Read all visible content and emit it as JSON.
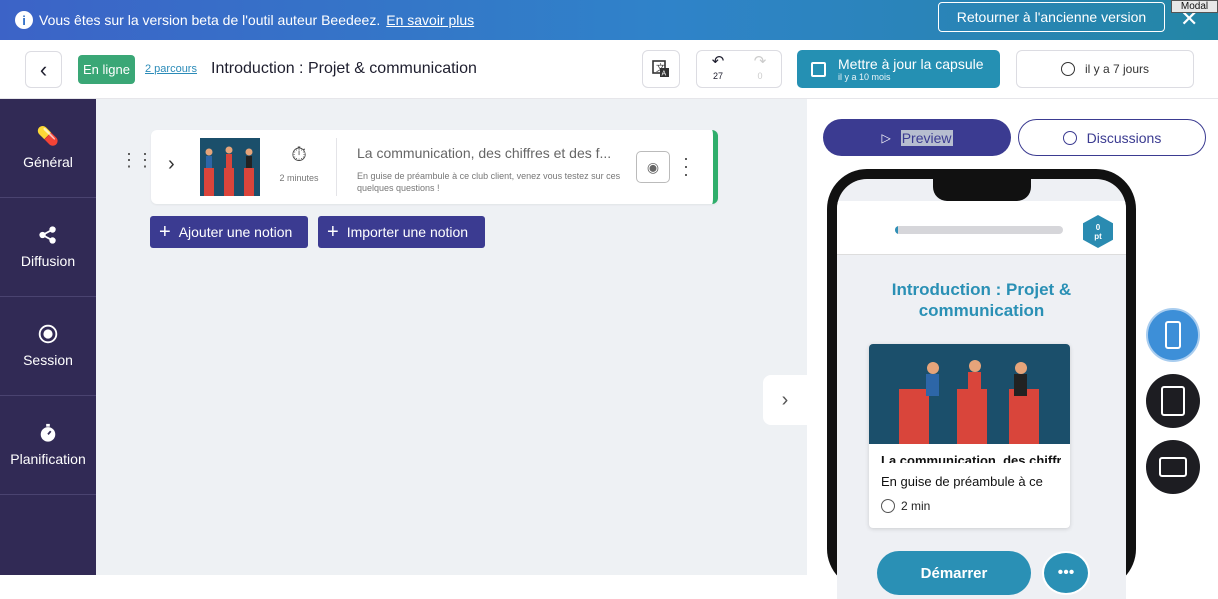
{
  "banner": {
    "message": "Vous êtes sur la version beta de l'outil auteur Beedeez.",
    "link": "En savoir plus",
    "old_version_button": "Retourner à l'ancienne version",
    "close": "✕",
    "modal_tag": "Modal"
  },
  "header": {
    "status_badge": "En ligne",
    "parcours_link": "2 parcours",
    "title": "Introduction : Projet & communication",
    "undo_count": "27",
    "redo_count": "0",
    "save_label": "Mettre à jour la capsule",
    "save_sub": "il y a 10 mois",
    "history_label": "il y a 7 jours"
  },
  "sidebar": {
    "items": [
      {
        "label": "Général",
        "icon": "pill-icon"
      },
      {
        "label": "Diffusion",
        "icon": "share-icon"
      },
      {
        "label": "Session",
        "icon": "target-icon"
      },
      {
        "label": "Planification",
        "icon": "stopwatch-icon"
      }
    ]
  },
  "notion": {
    "duration": "2 minutes",
    "title": "La communication, des chiffres et des f...",
    "description": "En guise de préambule à ce club client, venez vous testez sur ces quelques questions !"
  },
  "actions": {
    "add_notion": "Ajouter une notion",
    "import_notion": "Importer une notion"
  },
  "preview_panel": {
    "preview_label": "Preview",
    "discussions_label": "Discussions",
    "points_value": "0",
    "points_unit": "pt",
    "progress": 0.02,
    "capsule_title": "Introduction : Projet & communication",
    "card_title": "La communication, des chiffres et des faits",
    "card_desc": "En guise de préambule à ce",
    "card_duration": "2 min",
    "start_label": "Démarrer"
  },
  "colors": {
    "sidebar": "#312a55",
    "accent": "#2a90b5",
    "primary": "#3b3b91",
    "online": "#3aa776"
  }
}
